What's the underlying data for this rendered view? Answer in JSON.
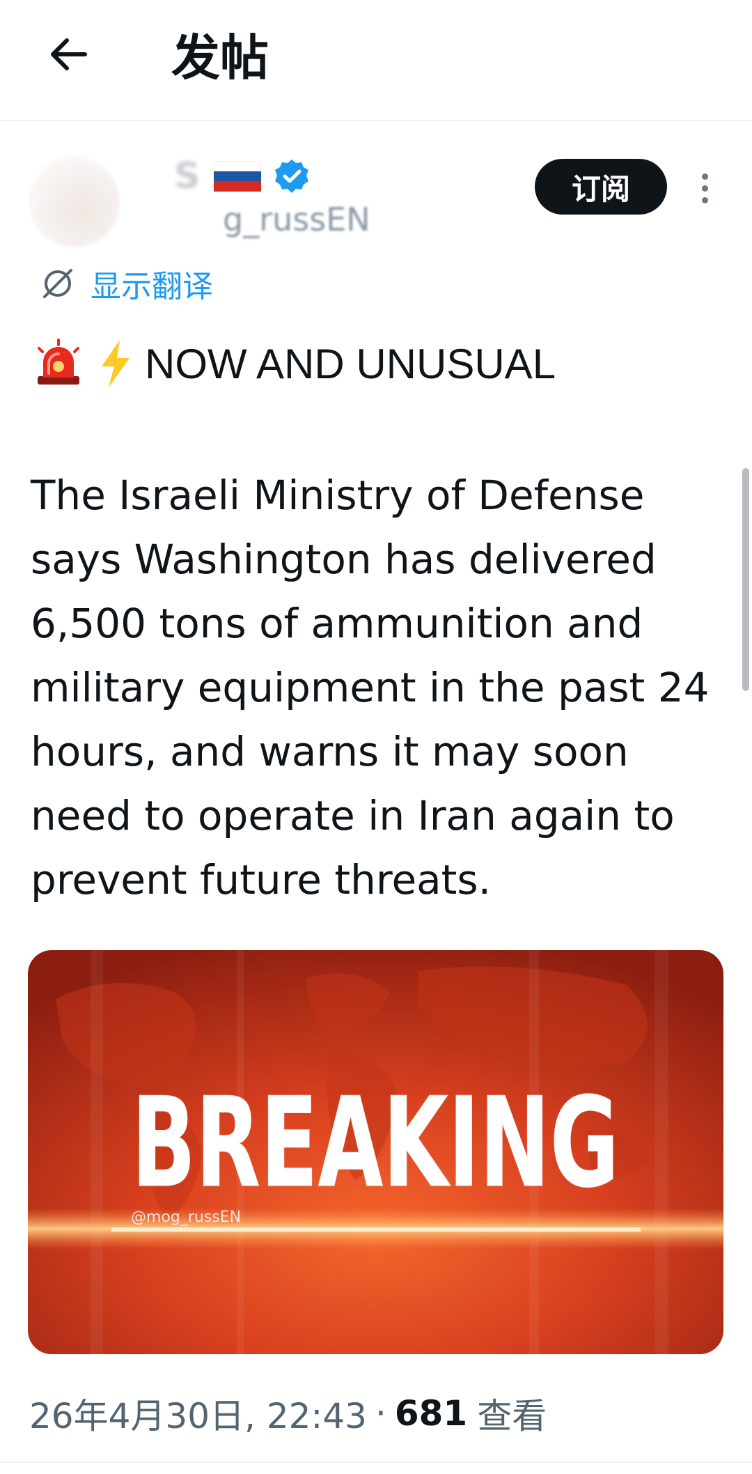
{
  "header": {
    "title": "发帖"
  },
  "author": {
    "display_name": "S",
    "handle": "g_russEN",
    "flag": "russia-flag-icon",
    "verified": true
  },
  "actions": {
    "subscribe_label": "订阅"
  },
  "translate": {
    "label": "显示翻译"
  },
  "tweet": {
    "headline": "NOW AND UNUSUAL",
    "body": "The Israeli Ministry of Defense says Washington has delivered 6,500 tons of ammunition and military equipment in the past 24 hours, and warns it may soon need to operate in Iran again to prevent future threats."
  },
  "media": {
    "title": "BREAKING",
    "watermark": "@mog_russEN"
  },
  "meta": {
    "timestamp": "26年4月30日, 22:43",
    "separator": "·",
    "views": "681",
    "views_label": "查看"
  },
  "colors": {
    "accent": "#1d9bf0",
    "text": "#0f1419",
    "muted": "#536471",
    "breaking_red": "#d8401f"
  }
}
